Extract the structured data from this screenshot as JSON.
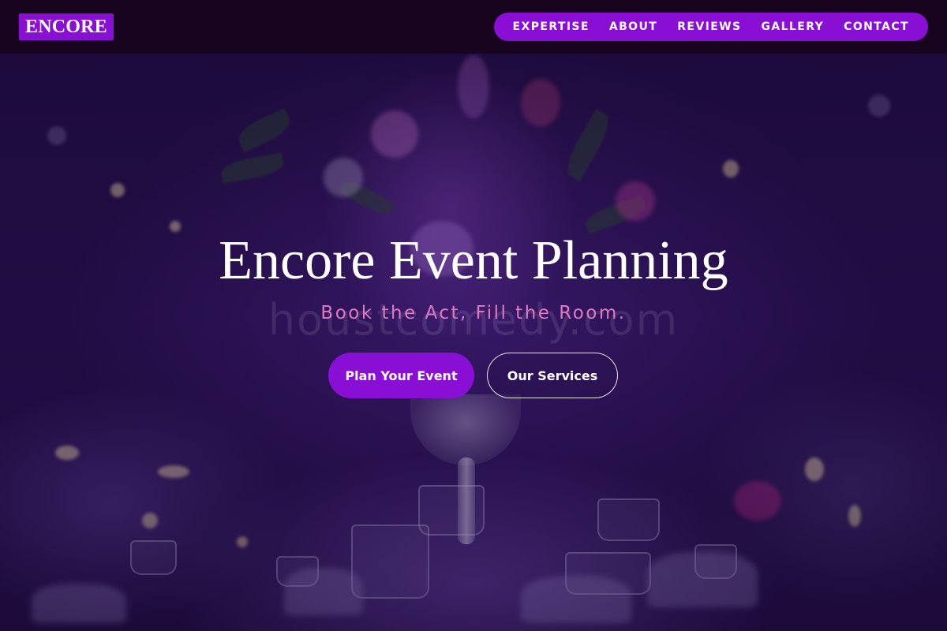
{
  "header": {
    "logo": "ENCORE",
    "nav": [
      {
        "label": "EXPERTISE"
      },
      {
        "label": "ABOUT"
      },
      {
        "label": "REVIEWS"
      },
      {
        "label": "GALLERY"
      },
      {
        "label": "CONTACT"
      }
    ]
  },
  "hero": {
    "title": "Encore Event Planning",
    "tagline": "Book the Act, Fill the Room.",
    "watermark": "houstcomedy.com",
    "primary_button": "Plan Your Event",
    "secondary_button": "Our Services"
  },
  "colors": {
    "accent": "#8a0fd4",
    "header_bg": "#17041f",
    "tagline": "#e07ac0"
  }
}
